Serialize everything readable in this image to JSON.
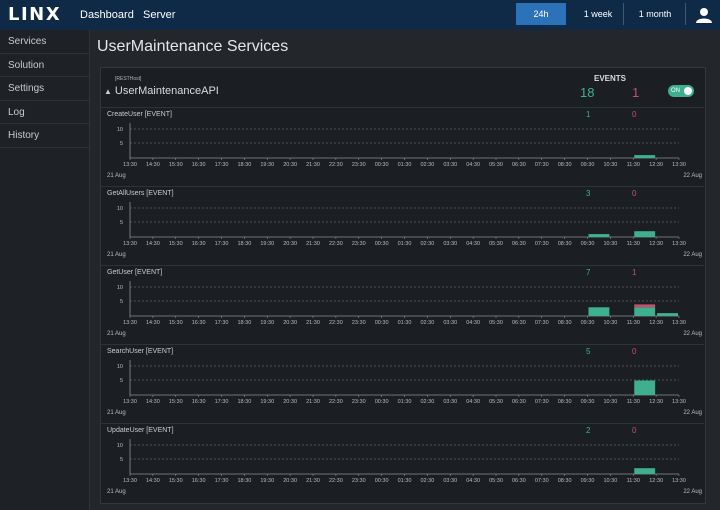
{
  "header": {
    "logo": "LINX",
    "nav": [
      "Dashboard",
      "Server"
    ],
    "ranges": [
      {
        "label": "24h",
        "active": true
      },
      {
        "label": "1 week",
        "active": false
      },
      {
        "label": "1 month",
        "active": false
      }
    ],
    "user_icon": "user-icon"
  },
  "sidebar": {
    "items": [
      "Services",
      "Solution",
      "Settings",
      "Log",
      "History"
    ]
  },
  "main": {
    "title": "UserMaintenance Services",
    "api": {
      "tag": "[RESTHost]",
      "name": "UserMaintenanceAPI",
      "events_label": "EVENTS",
      "events_ok": "18",
      "events_error": "1",
      "toggle_label": "ON",
      "toggle_on": true
    }
  },
  "colors": {
    "ok": "#3fb08f",
    "error": "#c2536a",
    "accent": "#2b72b9",
    "header": "#0e2a47"
  },
  "chart_data": [
    {
      "type": "bar",
      "title": "CreateUser [EVENT]",
      "ok_total": "1",
      "error_total": "0",
      "x_ticks": [
        "13:30",
        "14:30",
        "15:30",
        "16:30",
        "17:30",
        "18:30",
        "19:30",
        "20:30",
        "21:30",
        "22:30",
        "23:30",
        "00:30",
        "01:30",
        "02:30",
        "03:30",
        "04:30",
        "05:30",
        "06:30",
        "07:30",
        "08:30",
        "09:30",
        "10:30",
        "11:30",
        "12:30",
        "13:30"
      ],
      "y_ticks": [
        "10",
        "5"
      ],
      "ylim": [
        0,
        10
      ],
      "start_date": "21 Aug",
      "end_date": "22 Aug",
      "grid": true,
      "bars": [
        {
          "bin": 22,
          "ok": 1,
          "error": 0
        }
      ]
    },
    {
      "type": "bar",
      "title": "GetAllUsers [EVENT]",
      "ok_total": "3",
      "error_total": "0",
      "x_ticks": [
        "13:30",
        "14:30",
        "15:30",
        "16:30",
        "17:30",
        "18:30",
        "19:30",
        "20:30",
        "21:30",
        "22:30",
        "23:30",
        "00:30",
        "01:30",
        "02:30",
        "03:30",
        "04:30",
        "05:30",
        "06:30",
        "07:30",
        "08:30",
        "09:30",
        "10:30",
        "11:30",
        "12:30",
        "13:30"
      ],
      "y_ticks": [
        "10",
        "5"
      ],
      "ylim": [
        0,
        10
      ],
      "start_date": "21 Aug",
      "end_date": "22 Aug",
      "grid": true,
      "bars": [
        {
          "bin": 20,
          "ok": 1,
          "error": 0
        },
        {
          "bin": 22,
          "ok": 2,
          "error": 0
        }
      ]
    },
    {
      "type": "bar",
      "title": "GetUser [EVENT]",
      "ok_total": "7",
      "error_total": "1",
      "x_ticks": [
        "13:30",
        "14:30",
        "15:30",
        "16:30",
        "17:30",
        "18:30",
        "19:30",
        "20:30",
        "21:30",
        "22:30",
        "23:30",
        "00:30",
        "01:30",
        "02:30",
        "03:30",
        "04:30",
        "05:30",
        "06:30",
        "07:30",
        "08:30",
        "09:30",
        "10:30",
        "11:30",
        "12:30",
        "13:30"
      ],
      "y_ticks": [
        "10",
        "5"
      ],
      "ylim": [
        0,
        10
      ],
      "start_date": "21 Aug",
      "end_date": "22 Aug",
      "grid": true,
      "bars": [
        {
          "bin": 20,
          "ok": 3,
          "error": 0
        },
        {
          "bin": 22,
          "ok": 3,
          "error": 1
        },
        {
          "bin": 23,
          "ok": 1,
          "error": 0
        }
      ]
    },
    {
      "type": "bar",
      "title": "SearchUser [EVENT]",
      "ok_total": "5",
      "error_total": "0",
      "x_ticks": [
        "13:30",
        "14:30",
        "15:30",
        "16:30",
        "17:30",
        "18:30",
        "19:30",
        "20:30",
        "21:30",
        "22:30",
        "23:30",
        "00:30",
        "01:30",
        "02:30",
        "03:30",
        "04:30",
        "05:30",
        "06:30",
        "07:30",
        "08:30",
        "09:30",
        "10:30",
        "11:30",
        "12:30",
        "13:30"
      ],
      "y_ticks": [
        "10",
        "5"
      ],
      "ylim": [
        0,
        10
      ],
      "start_date": "21 Aug",
      "end_date": "22 Aug",
      "grid": true,
      "bars": [
        {
          "bin": 22,
          "ok": 5,
          "error": 0
        }
      ]
    },
    {
      "type": "bar",
      "title": "UpdateUser [EVENT]",
      "ok_total": "2",
      "error_total": "0",
      "x_ticks": [
        "13:30",
        "14:30",
        "15:30",
        "16:30",
        "17:30",
        "18:30",
        "19:30",
        "20:30",
        "21:30",
        "22:30",
        "23:30",
        "00:30",
        "01:30",
        "02:30",
        "03:30",
        "04:30",
        "05:30",
        "06:30",
        "07:30",
        "08:30",
        "09:30",
        "10:30",
        "11:30",
        "12:30",
        "13:30"
      ],
      "y_ticks": [
        "10",
        "5"
      ],
      "ylim": [
        0,
        10
      ],
      "start_date": "21 Aug",
      "end_date": "22 Aug",
      "grid": true,
      "bars": [
        {
          "bin": 22,
          "ok": 2,
          "error": 0
        }
      ]
    }
  ]
}
